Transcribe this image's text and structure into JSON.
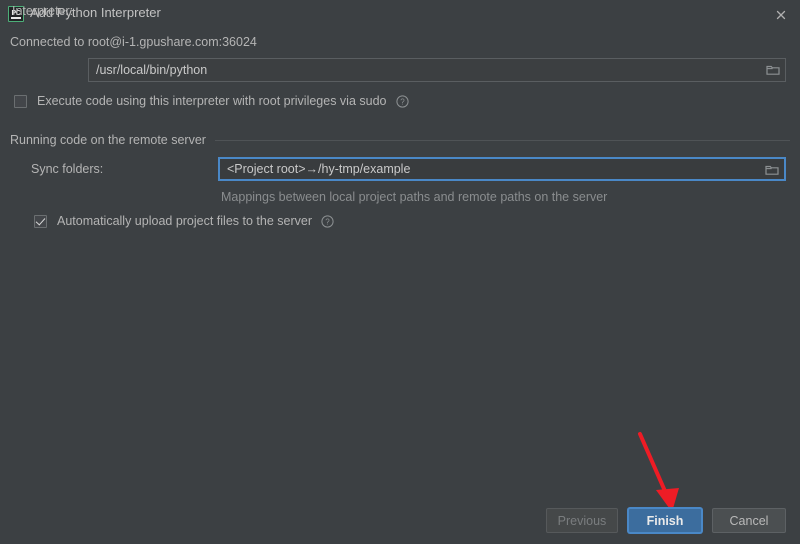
{
  "window": {
    "title": "Add Python Interpreter",
    "app_icon": "pycharm-icon",
    "close_icon": "close-icon",
    "background_color": "#3c4043"
  },
  "content": {
    "connection_status": "Connected to root@i-1.gpushare.com:36024",
    "interpreter": {
      "label": "Interpreter:",
      "value": "/usr/local/bin/python",
      "browse_icon": "folder-icon"
    },
    "sudo_checkbox": {
      "label": "Execute code using this interpreter with root privileges via sudo",
      "checked": false,
      "help_icon": "help-icon"
    },
    "section": {
      "title": "Running code on the remote server"
    },
    "sync_folders": {
      "label": "Sync folders:",
      "value": "<Project root>→/hy-tmp/example",
      "hint": "Mappings between local project paths and remote paths on the server",
      "browse_icon": "folder-icon",
      "focused": true,
      "focus_color": "#4a88c7"
    },
    "auto_upload_checkbox": {
      "label": "Automatically upload project files to the server",
      "checked": true,
      "help_icon": "help-icon"
    }
  },
  "footer": {
    "previous_label": "Previous",
    "finish_label": "Finish",
    "cancel_label": "Cancel",
    "primary_color": "#3c6d9e"
  },
  "annotation": {
    "arrow_color": "#ee1c25",
    "points_to": "Finish"
  }
}
